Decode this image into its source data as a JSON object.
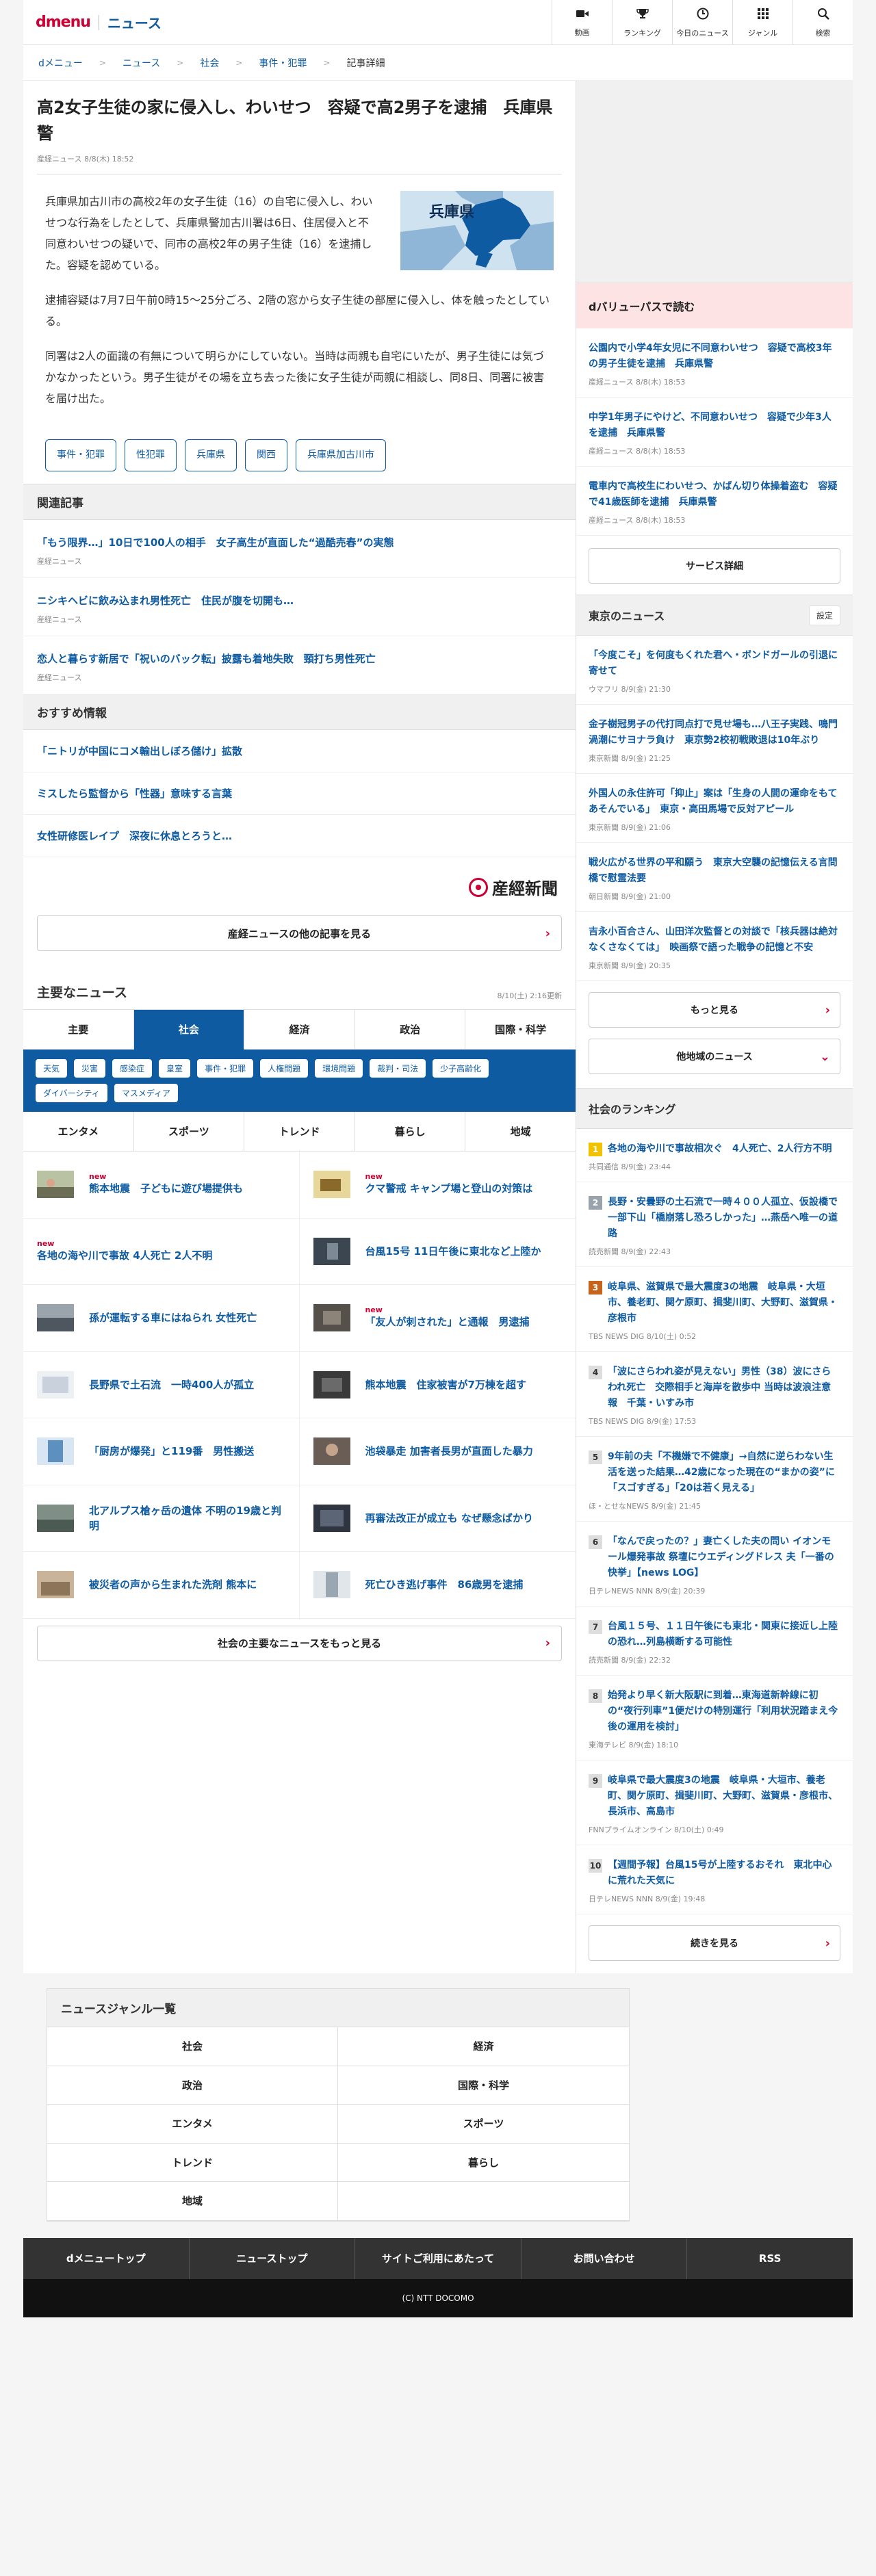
{
  "header": {
    "logo_d": "dmenu",
    "logo_news": "ニュース",
    "nav": [
      {
        "label": "動画",
        "icon": "video-camera-icon"
      },
      {
        "label": "ランキング",
        "icon": "trophy-icon"
      },
      {
        "label": "今日のニュース",
        "icon": "clock-icon"
      },
      {
        "label": "ジャンル",
        "icon": "grid-icon"
      },
      {
        "label": "検索",
        "icon": "search-icon"
      }
    ]
  },
  "breadcrumb": [
    "dメニュー",
    "ニュース",
    "社会",
    "事件・犯罪",
    "記事詳細"
  ],
  "article": {
    "title": "高2女子生徒の家に侵入し、わいせつ　容疑で高2男子を逮捕　兵庫県警",
    "meta": "産経ニュース  8/8(木) 18:52",
    "map_label": "兵庫県",
    "paragraphs": [
      "兵庫県加古川市の高校2年の女子生徒（16）の自宅に侵入し、わいせつな行為をしたとして、兵庫県警加古川署は6日、住居侵入と不同意わいせつの疑いで、同市の高校2年の男子生徒（16）を逮捕した。容疑を認めている。",
      "逮捕容疑は7月7日午前0時15～25分ごろ、2階の窓から女子生徒の部屋に侵入し、体を触ったとしている。",
      "同署は2人の面識の有無について明らかにしていない。当時は両親も自宅にいたが、男子生徒には気づかなかったという。男子生徒がその場を立ち去った後に女子生徒が両親に相談し、同8日、同署に被害を届け出た。"
    ],
    "tags": [
      "事件・犯罪",
      "性犯罪",
      "兵庫県",
      "関西",
      "兵庫県加古川市"
    ]
  },
  "related": {
    "heading": "関連記事",
    "items": [
      {
        "title": "「もう限界…」10日で100人の相手　女子高生が直面した“過酷売春”の実態",
        "source": "産経ニュース"
      },
      {
        "title": "ニシキヘビに飲み込まれ男性死亡　住民が腹を切開も…",
        "source": "産経ニュース"
      },
      {
        "title": "恋人と暮らす新居で「祝いのバック転」披露も着地失敗　頸打ち男性死亡",
        "source": "産経ニュース"
      }
    ]
  },
  "recommend": {
    "heading": "おすすめ情報",
    "items": [
      "「ニトリが中国にコメ輸出しぼろ儲け」拡散",
      "ミスしたら監督から「性器」意味する言葉",
      "女性研修医レイプ　深夜に休息とろうと…"
    ]
  },
  "sankei": {
    "logo_text": "産經新聞",
    "more": "産経ニュースの他の記事を見る"
  },
  "major": {
    "title": "主要なニュース",
    "updated": "8/10(土) 2:16更新",
    "tabs": [
      "主要",
      "社会",
      "経済",
      "政治",
      "国際・科学"
    ],
    "subtags": [
      "天気",
      "災害",
      "感染症",
      "皇室",
      "事件・犯罪",
      "人権問題",
      "環境問題",
      "裁判・司法",
      "少子高齢化",
      "ダイバーシティ",
      "マスメディア"
    ],
    "tabs2": [
      "エンタメ",
      "スポーツ",
      "トレンド",
      "暮らし",
      "地域"
    ],
    "news": [
      {
        "title": "熊本地震　子どもに遊び場提供も",
        "new": "new"
      },
      {
        "title": "クマ警戒 キャンプ場と登山の対策は",
        "new": "new"
      },
      {
        "title": "各地の海や川で事故 4人死亡 2人不明",
        "new": "new"
      },
      {
        "title": "台風15号 11日午後に東北など上陸か",
        "new": ""
      },
      {
        "title": "孫が運転する車にはねられ 女性死亡",
        "new": ""
      },
      {
        "title": "「友人が刺された」と通報　男逮捕",
        "new": "new"
      },
      {
        "title": "長野県で土石流　一時400人が孤立",
        "new": ""
      },
      {
        "title": "熊本地震　住家被害が7万棟を超す",
        "new": ""
      },
      {
        "title": "「厨房が爆発」と119番　男性搬送",
        "new": ""
      },
      {
        "title": "池袋暴走 加害者長男が直面した暴力",
        "new": ""
      },
      {
        "title": "北アルプス槍ヶ岳の遺体 不明の19歳と判明",
        "new": ""
      },
      {
        "title": "再審法改正が成立も なぜ懸念ばかり",
        "new": ""
      },
      {
        "title": "被災者の声から生まれた洗剤 熊本に",
        "new": ""
      },
      {
        "title": "死亡ひき逃げ事件　86歳男を逮捕",
        "new": ""
      }
    ],
    "more": "社会の主要なニュースをもっと見る"
  },
  "side": {
    "dvalue": {
      "heading": "dバリューパスで読む",
      "items": [
        {
          "title": "公園内で小学4年女児に不同意わいせつ　容疑で高校3年の男子生徒を逮捕　兵庫県警",
          "source": "産経ニュース  8/8(木) 18:53"
        },
        {
          "title": "中学1年男子にやけど、不同意わいせつ　容疑で少年3人を逮捕　兵庫県警",
          "source": "産経ニュース  8/8(木) 18:53"
        },
        {
          "title": "電車内で高校生にわいせつ、かばん切り体操着盗む　容疑で41歳医師を逮捕　兵庫県警",
          "source": "産経ニュース  8/8(木) 18:53"
        }
      ],
      "button": "サービス詳細"
    },
    "tokyo": {
      "heading": "東京のニュース",
      "setting": "設定",
      "items": [
        {
          "title": "「今度こそ」を何度もくれた君へ・ボンドガールの引退に寄せて",
          "source": "ウマフリ  8/9(金) 21:30"
        },
        {
          "title": "金子樹冠男子の代打同点打で見せ場も…八王子実践、鳴門渦潮にサヨナラ負け　東京勢2校初戦敗退は10年ぶり",
          "source": "東京新聞  8/9(金) 21:25"
        },
        {
          "title": "外国人の永住許可「抑止」案は「生身の人間の運命をもてあそんでいる」　東京・高田馬場で反対アピール",
          "source": "東京新聞  8/9(金) 21:06"
        },
        {
          "title": "戦火広がる世界の平和願う　東京大空襲の記憶伝える言問橋で慰霊法要",
          "source": "朝日新聞  8/9(金) 21:00"
        },
        {
          "title": "吉永小百合さん、山田洋次監督との対談で「核兵器は絶対なくさなくては」　映画祭で語った戦争の記憶と不安",
          "source": "東京新聞  8/9(金) 20:35"
        }
      ],
      "more": "もっと見る",
      "other": "他地域のニュース"
    },
    "ranking": {
      "heading": "社会のランキング",
      "items": [
        {
          "no": "1",
          "title": "各地の海や川で事故相次ぐ　4人死亡、2人行方不明",
          "source": "共同通信  8/9(金) 23:44"
        },
        {
          "no": "2",
          "title": "長野・安曇野の土石流で一時４００人孤立、仮設橋で一部下山「橋崩落し恐ろしかった」…燕岳へ唯一の道路",
          "source": "読売新聞  8/9(金) 22:43"
        },
        {
          "no": "3",
          "title": "岐阜県、滋賀県で最大震度3の地震　岐阜県・大垣市、養老町、関ケ原町、揖斐川町、大野町、滋賀県・彦根市",
          "source": "TBS NEWS DIG  8/10(土) 0:52"
        },
        {
          "no": "4",
          "title": "「波にさらわれ姿が見えない」男性（38）波にさらわれ死亡　交際相手と海岸を散歩中 当時は波浪注意報　千葉・いすみ市",
          "source": "TBS NEWS DIG  8/9(金) 17:53"
        },
        {
          "no": "5",
          "title": "9年前の夫「不機嫌で不健康」→自然に逆らわない生活を送った結果…42歳になった現在の“まかの姿”に「スゴすぎる」「20は若く見える」",
          "source": "ほ・とせなNEWS  8/9(金) 21:45"
        },
        {
          "no": "6",
          "title": "「なんで戻ったの？」妻亡くした夫の問い イオンモール爆発事故 祭壇にウエディングドレス 夫「一番の快挙」【news LOG】",
          "source": "日テレNEWS NNN  8/9(金) 20:39"
        },
        {
          "no": "7",
          "title": "台風１５号、１１日午後にも東北・関東に接近し上陸の恐れ…列島横断する可能性",
          "source": "読売新聞  8/9(金) 22:32"
        },
        {
          "no": "8",
          "title": "始発より早く新大阪駅に到着…東海道新幹線に初の“夜行列車”1便だけの特別運行「利用状況踏まえ今後の運用を検討」",
          "source": "東海テレビ  8/9(金) 18:10"
        },
        {
          "no": "9",
          "title": "岐阜県で最大震度3の地震　岐阜県・大垣市、養老町、関ケ原町、揖斐川町、大野町、滋賀県・彦根市、長浜市、高島市",
          "source": "FNNプライムオンライン  8/10(土) 0:49"
        },
        {
          "no": "10",
          "title": "【週間予報】台風15号が上陸するおそれ　東北中心に荒れた天気に",
          "source": "日テレNEWS NNN  8/9(金) 19:48"
        }
      ],
      "more": "続きを見る"
    }
  },
  "genre": {
    "heading": "ニュースジャンル一覧",
    "items": [
      "社会",
      "経済",
      "政治",
      "国際・科学",
      "エンタメ",
      "スポーツ",
      "トレンド",
      "暮らし",
      "地域",
      ""
    ]
  },
  "footer": {
    "nav": [
      "dメニュートップ",
      "ニューストップ",
      "サイトご利用にあたって",
      "お問い合わせ",
      "RSS"
    ],
    "copyright": "(C) NTT DOCOMO"
  }
}
